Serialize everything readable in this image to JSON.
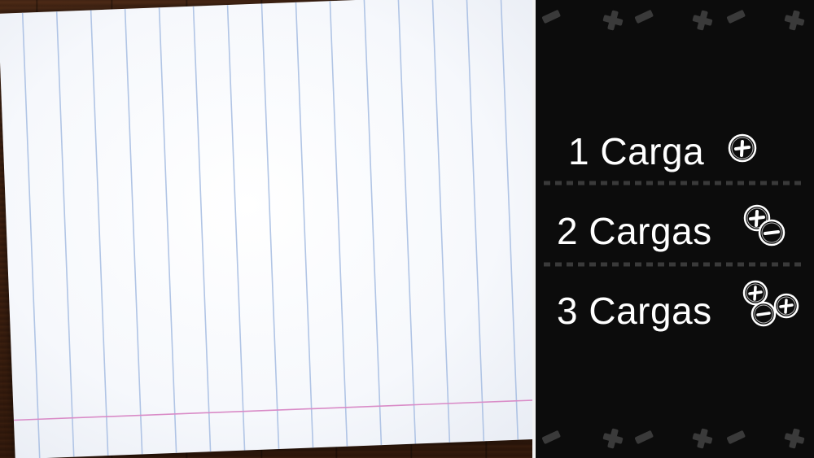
{
  "charges": [
    {
      "label": "1 Carga",
      "icons": [
        "plus-charge-icon"
      ]
    },
    {
      "label": "2 Cargas",
      "icons": [
        "plus-charge-icon",
        "minus-charge-icon"
      ]
    },
    {
      "label": "3 Cargas",
      "icons": [
        "plus-charge-icon",
        "minus-charge-icon",
        "plus-charge-icon"
      ]
    }
  ],
  "colors": {
    "panel_background": "#0c0c0c",
    "text": "#ffffff",
    "paper_rule_blue": "#a9bfe3",
    "paper_margin_pink": "#d98bc7",
    "decoration_gray": "#3a3a3a"
  }
}
